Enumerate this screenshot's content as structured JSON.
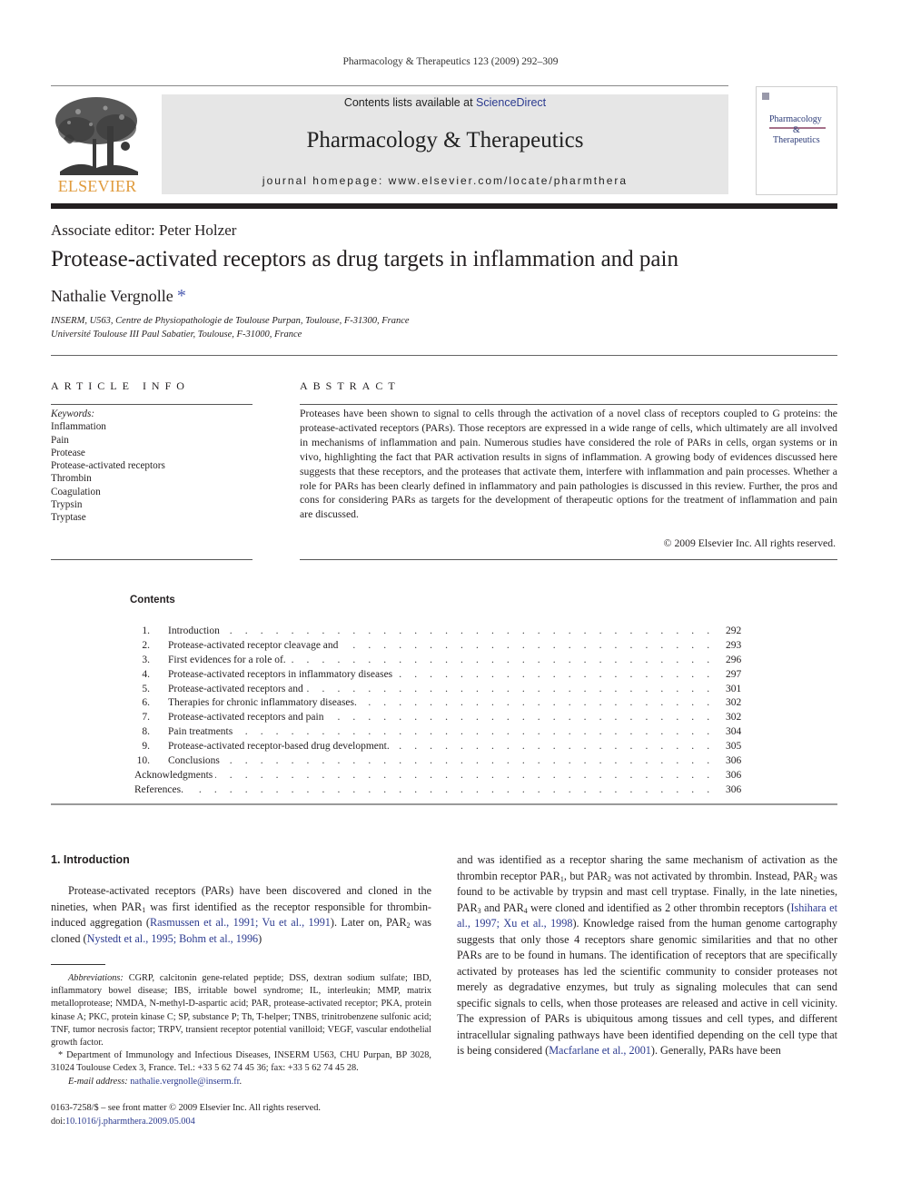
{
  "running_header": "Pharmacology & Therapeutics 123 (2009) 292–309",
  "masthead": {
    "publisher": "ELSEVIER",
    "contents_prefix": "Contents lists available at ",
    "contents_link": "ScienceDirect",
    "journal_title": "Pharmacology & Therapeutics",
    "homepage": "journal homepage: www.elsevier.com/locate/pharmthera",
    "cover_line1": "Pharmacology",
    "cover_amp": "&",
    "cover_line2": "Therapeutics",
    "link_color": "#2b3a8f",
    "logo_color": "#e09b3d"
  },
  "article": {
    "associate_editor": "Associate editor: Peter Holzer",
    "title": "Protease-activated receptors as drug targets in inflammation and pain",
    "author": "Nathalie Vergnolle",
    "author_mark": "*",
    "affiliations": [
      "INSERM, U563, Centre de Physiopathologie de Toulouse Purpan, Toulouse, F-31300, France",
      "Université Toulouse III Paul Sabatier, Toulouse, F-31000, France"
    ]
  },
  "article_info": {
    "heading": "ARTICLE INFO",
    "keywords_label": "Keywords:",
    "keywords": [
      "Inflammation",
      "Pain",
      "Protease",
      "Protease-activated receptors",
      "Thrombin",
      "Coagulation",
      "Trypsin",
      "Tryptase"
    ]
  },
  "abstract": {
    "heading": "ABSTRACT",
    "text": "Proteases have been shown to signal to cells through the activation of a novel class of receptors coupled to G proteins: the protease-activated receptors (PARs). Those receptors are expressed in a wide range of cells, which ultimately are all involved in mechanisms of inflammation and pain. Numerous studies have considered the role of PARs in cells, organ systems or in vivo, highlighting the fact that PAR activation results in signs of inflammation. A growing body of evidences discussed here suggests that these receptors, and the proteases that activate them, interfere with inflammation and pain processes. Whether a role for PARs has been clearly defined in inflammatory and pain pathologies is discussed in this review. Further, the pros and cons for considering PARs as targets for the development of therapeutic options for the treatment of inflammation and pain are discussed.",
    "copyright": "© 2009 Elsevier Inc. All rights reserved."
  },
  "contents": {
    "heading": "Contents",
    "dots": ". . . . . . . . . . . . . . . . . . . . . . . . . . . . . . . . . . . . . . . . . . . . . . . . . . . . . . . . . . . . . . . . . . . . . . . . . . . . . . . . . . . . . . . . . . . . . . . . . . . . . . . . . .",
    "items": [
      {
        "num": "1.",
        "title": "Introduction",
        "page": "292"
      },
      {
        "num": "2.",
        "title": "Protease-activated receptor cleavage and",
        "page": "293"
      },
      {
        "num": "3.",
        "title": "First evidences for a role of.",
        "page": "296"
      },
      {
        "num": "4.",
        "title": "Protease-activated receptors in inflammatory diseases",
        "page": "297"
      },
      {
        "num": "5.",
        "title": "Protease-activated receptors and",
        "page": "301"
      },
      {
        "num": "6.",
        "title": "Therapies for chronic inflammatory diseases.",
        "page": "302"
      },
      {
        "num": "7.",
        "title": "Protease-activated receptors and pain",
        "page": "302"
      },
      {
        "num": "8.",
        "title": "Pain treatments",
        "page": "304"
      },
      {
        "num": "9.",
        "title": "Protease-activated receptor-based drug development.",
        "page": "305"
      },
      {
        "num": "10.",
        "title": "Conclusions",
        "page": "306"
      },
      {
        "num": "",
        "title": "Acknowledgments",
        "page": "306"
      },
      {
        "num": "",
        "title": "References.",
        "page": "306"
      }
    ]
  },
  "body": {
    "section_heading": "1. Introduction",
    "left_col": {
      "t1": "Protease-activated receptors (PARs) have been discovered and cloned in the nineties, when PAR",
      "sub1": "1",
      "t2": " was first identified as the receptor responsible for thrombin-induced aggregation (",
      "cite1": "Rasmussen et al., 1991; Vu et al., 1991",
      "t3": "). Later on, PAR",
      "sub2": "2",
      "t4": " was cloned (",
      "cite2": "Nystedt et al., 1995; Bohm et al., 1996",
      "t5": ")"
    },
    "right_col": {
      "t1": "and was identified as a receptor sharing the same mechanism of activation as the thrombin receptor PAR",
      "sub1": "1",
      "t2": ", but PAR",
      "sub2": "2",
      "t3": " was not activated by thrombin. Instead, PAR",
      "sub3": "2",
      "t4": " was found to be activable by trypsin and mast cell tryptase. Finally, in the late nineties, PAR",
      "sub4": "3",
      "t5": " and PAR",
      "sub5": "4",
      "t6": " were cloned and identified as 2 other thrombin receptors (",
      "cite1": "Ishihara et al., 1997; Xu et al., 1998",
      "t7": "). Knowledge raised from the human genome cartography suggests that only those 4 receptors share genomic similarities and that no other PARs are to be found in humans. The identification of receptors that are specifically activated by proteases has led the scientific community to consider proteases not merely as degradative enzymes, but truly as signaling molecules that can send specific signals to cells, when those proteases are released and active in cell vicinity. The expression of PARs is ubiquitous among tissues and cell types, and different intracellular signaling pathways have been identified depending on the cell type that is being considered (",
      "cite2": "Macfarlane et al., 2001",
      "t8": "). Generally, PARs have been"
    }
  },
  "footnotes": {
    "abbr_label": "Abbreviations:",
    "abbr_text": " CGRP, calcitonin gene-related peptide; DSS, dextran sodium sulfate; IBD, inflammatory bowel disease; IBS, irritable bowel syndrome; IL, interleukin; MMP, matrix metalloprotease; NMDA, N-methyl-D-aspartic acid; PAR, protease-activated receptor; PKA, protein kinase A; PKC, protein kinase C; SP, substance P; Th, T-helper; TNBS, trinitrobenzene sulfonic acid; TNF, tumor necrosis factor; TRPV, transient receptor potential vanilloid; VEGF, vascular endothelial growth factor.",
    "corresponding": "* Department of Immunology and Infectious Diseases, INSERM U563, CHU Purpan, BP 3028, 31024 Toulouse Cedex 3, France. Tel.: +33 5 62 74 45 36; fax: +33 5 62 74 45 28.",
    "email_label": "E-mail address:",
    "email": "nathalie.vergnolle@inserm.fr",
    "email_end": "."
  },
  "front_matter": {
    "issn_line": "0163-7258/$ – see front matter © 2009 Elsevier Inc. All rights reserved.",
    "doi_prefix": "doi:",
    "doi": "10.1016/j.pharmthera.2009.05.004"
  }
}
